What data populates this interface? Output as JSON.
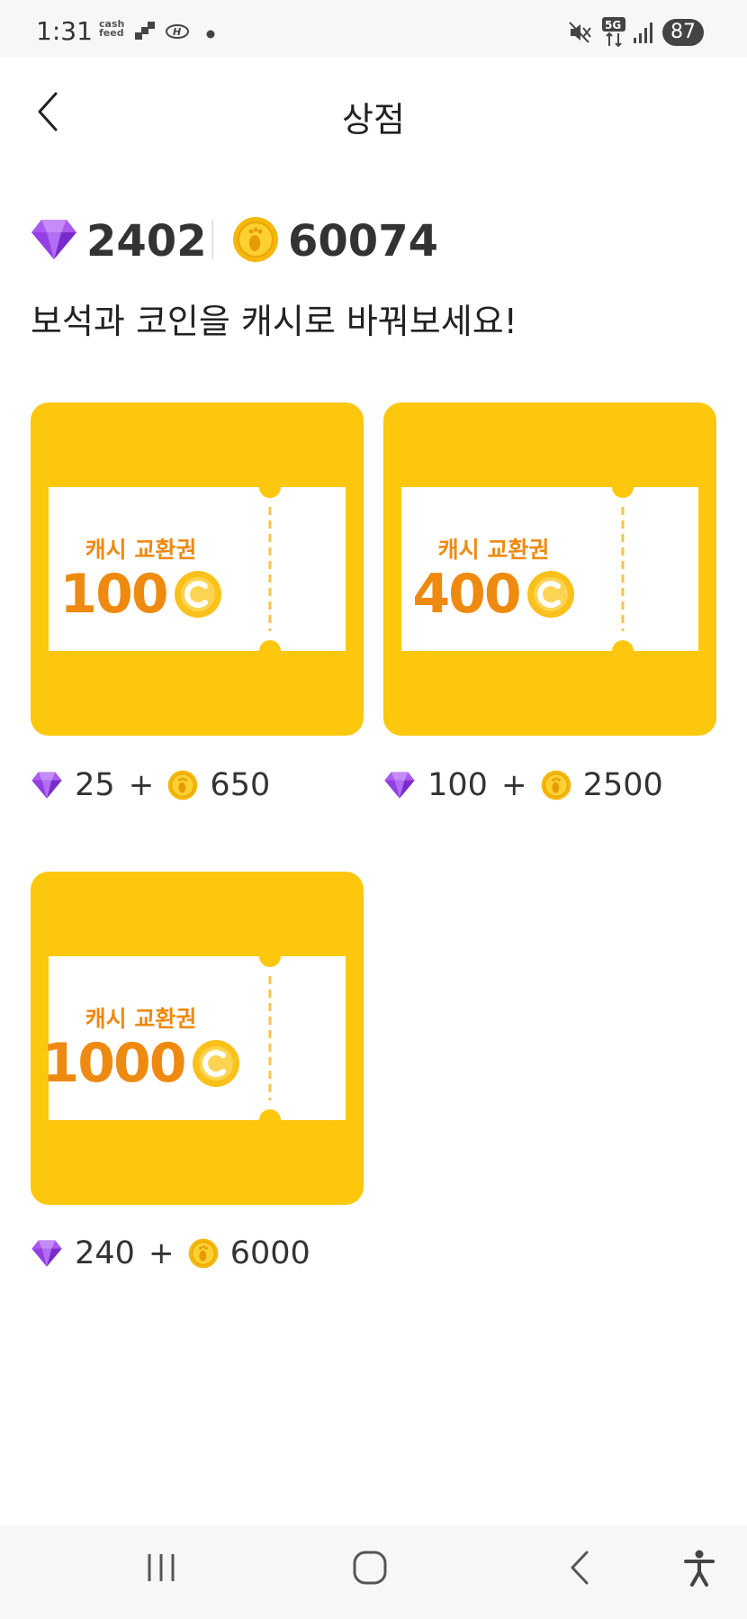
{
  "status_bar": {
    "time": "1:31",
    "cash_label": "cash feed",
    "battery": "87"
  },
  "header": {
    "title": "상점"
  },
  "balance": {
    "gems": "2402",
    "coins": "60074"
  },
  "subtitle": "보석과 코인을 캐시로 바꿔보세요!",
  "products": [
    {
      "ticket_title": "캐시 교환권",
      "ticket_amount": "100",
      "gem_price": "25",
      "plus": "+",
      "coin_price": "650"
    },
    {
      "ticket_title": "캐시 교환권",
      "ticket_amount": "400",
      "gem_price": "100",
      "plus": "+",
      "coin_price": "2500"
    },
    {
      "ticket_title": "캐시 교환권",
      "ticket_amount": "1000",
      "gem_price": "240",
      "plus": "+",
      "coin_price": "6000"
    }
  ],
  "colors": {
    "card_yellow": "#FCC70C",
    "ticket_orange": "#EE8A10",
    "gem_purple": "#9B4DEB",
    "coin_yellow": "#F5B70A"
  },
  "icons": [
    "back-icon",
    "gem-icon",
    "coin-icon",
    "recent-apps-icon",
    "home-icon",
    "nav-back-icon",
    "accessibility-icon"
  ]
}
